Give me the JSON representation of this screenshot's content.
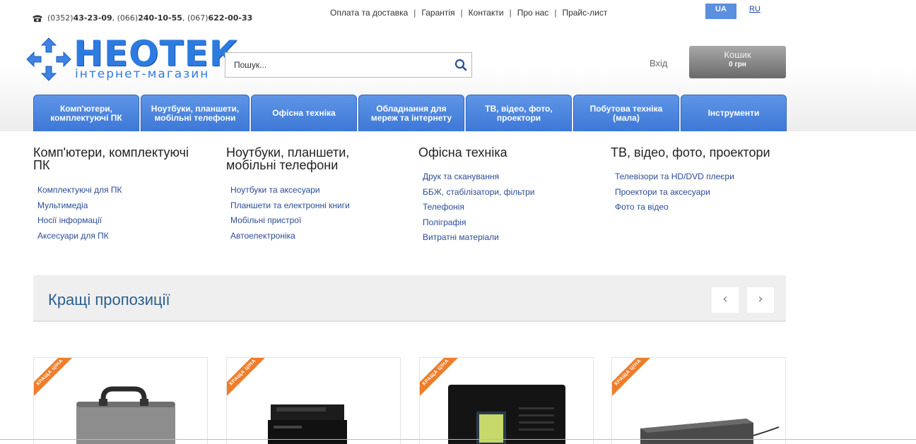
{
  "header": {
    "phones": [
      {
        "code": "(0352)",
        "number": "43-23-09"
      },
      {
        "code": "(066)",
        "number": "240-10-55"
      },
      {
        "code": "(067)",
        "number": "622-00-33"
      }
    ],
    "top_links": [
      "Оплата та доставка",
      "Гарантія",
      "Контакти",
      "Про нас",
      "Прайс-лист"
    ],
    "lang_active": "UA",
    "lang_other": "RU",
    "logo_title": "НЕОТЕК",
    "logo_subtitle": "інтернет-магазин",
    "search_placeholder": "Пошук...",
    "login_label": "Вхід",
    "cart_title": "Кошик",
    "cart_sum": "0 грн"
  },
  "nav": [
    "Комп'ютери, комплектуючі ПК",
    "Ноутбуки, планшети, мобільні телефони",
    "Офісна техніка",
    "Обладнання для мереж та інтернету",
    "ТВ, відео, фото, проектори",
    "Побутова техніка (мала)",
    "Інструменти"
  ],
  "categories": [
    {
      "title": "Комп'ютери, комплектуючі ПК",
      "items": [
        "Комплектуючі для ПК",
        "Мультимедіа",
        "Носії інформації",
        "Аксесуари для ПК"
      ]
    },
    {
      "title": "Ноутбуки, планшети, мобільні телефони",
      "items": [
        "Ноутбуки та аксесуари",
        "Планшети та електронні книги",
        "Мобільні пристрої",
        "Автоелектроніка"
      ]
    },
    {
      "title": "Офісна техніка",
      "items": [
        "Друк та сканування",
        "ББЖ, стабілізатори, фільтри",
        "Телефонія",
        "Поліграфія",
        "Витратні матеріали"
      ]
    },
    {
      "title": "ТВ, відео, фото, проектори",
      "items": [
        "Телевізори та HD/DVD плеєри",
        "Проектори та аксесуари",
        "Фото та відео"
      ]
    }
  ],
  "offers": {
    "title": "Кращі пропозиції",
    "prev": "‹",
    "next": "›",
    "badge": "КРАЩА ЦІНА"
  },
  "colors": {
    "accent": "#3e78d6",
    "ribbon": "#ef7d2a",
    "link": "#2a4d97"
  }
}
